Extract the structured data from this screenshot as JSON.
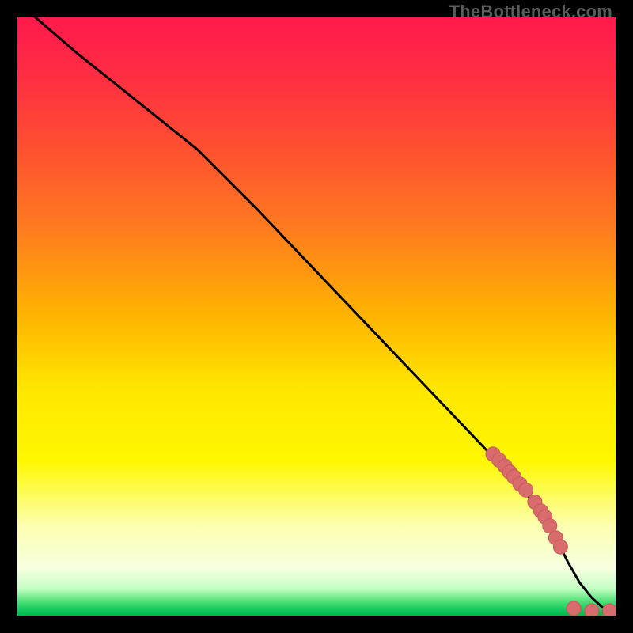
{
  "watermark": "TheBottleneck.com",
  "colors": {
    "gradient_stops": [
      {
        "offset": 0.0,
        "color": "#ff1a4b"
      },
      {
        "offset": 0.1,
        "color": "#ff2e43"
      },
      {
        "offset": 0.22,
        "color": "#ff5030"
      },
      {
        "offset": 0.35,
        "color": "#ff7a20"
      },
      {
        "offset": 0.5,
        "color": "#ffb400"
      },
      {
        "offset": 0.62,
        "color": "#ffe600"
      },
      {
        "offset": 0.74,
        "color": "#fff700"
      },
      {
        "offset": 0.85,
        "color": "#fcffb0"
      },
      {
        "offset": 0.92,
        "color": "#f7ffe0"
      },
      {
        "offset": 0.955,
        "color": "#c4ffc4"
      },
      {
        "offset": 0.975,
        "color": "#55e27a"
      },
      {
        "offset": 0.99,
        "color": "#15c95f"
      },
      {
        "offset": 1.0,
        "color": "#00b54e"
      }
    ],
    "line": "#000000",
    "dot_fill": "#d86b6b",
    "dot_stroke": "#c75a5a"
  },
  "chart_data": {
    "type": "line",
    "title": "",
    "xlabel": "",
    "ylabel": "",
    "xlim": [
      0,
      100
    ],
    "ylim": [
      0,
      100
    ],
    "series": [
      {
        "name": "curve",
        "x": [
          3,
          10,
          20,
          30,
          40,
          50,
          60,
          70,
          80,
          88,
          90,
          92,
          94,
          96,
          98,
          100
        ],
        "y": [
          100,
          94,
          86,
          78,
          68,
          57.5,
          47,
          36.5,
          26,
          17,
          13,
          9,
          5.5,
          3,
          1.2,
          0.6
        ]
      }
    ],
    "points": {
      "name": "dots",
      "x": [
        79.5,
        80.5,
        81.5,
        82.3,
        83.0,
        84.0,
        85.0,
        86.5,
        87.5,
        88.2,
        89.0,
        90.0,
        90.8,
        93.0,
        96.0,
        99.0
      ],
      "y": [
        27.0,
        26.0,
        25.0,
        24.0,
        23.2,
        22.0,
        21.0,
        19.0,
        17.5,
        16.5,
        15.0,
        13.0,
        11.5,
        1.2,
        0.8,
        0.8
      ]
    }
  }
}
